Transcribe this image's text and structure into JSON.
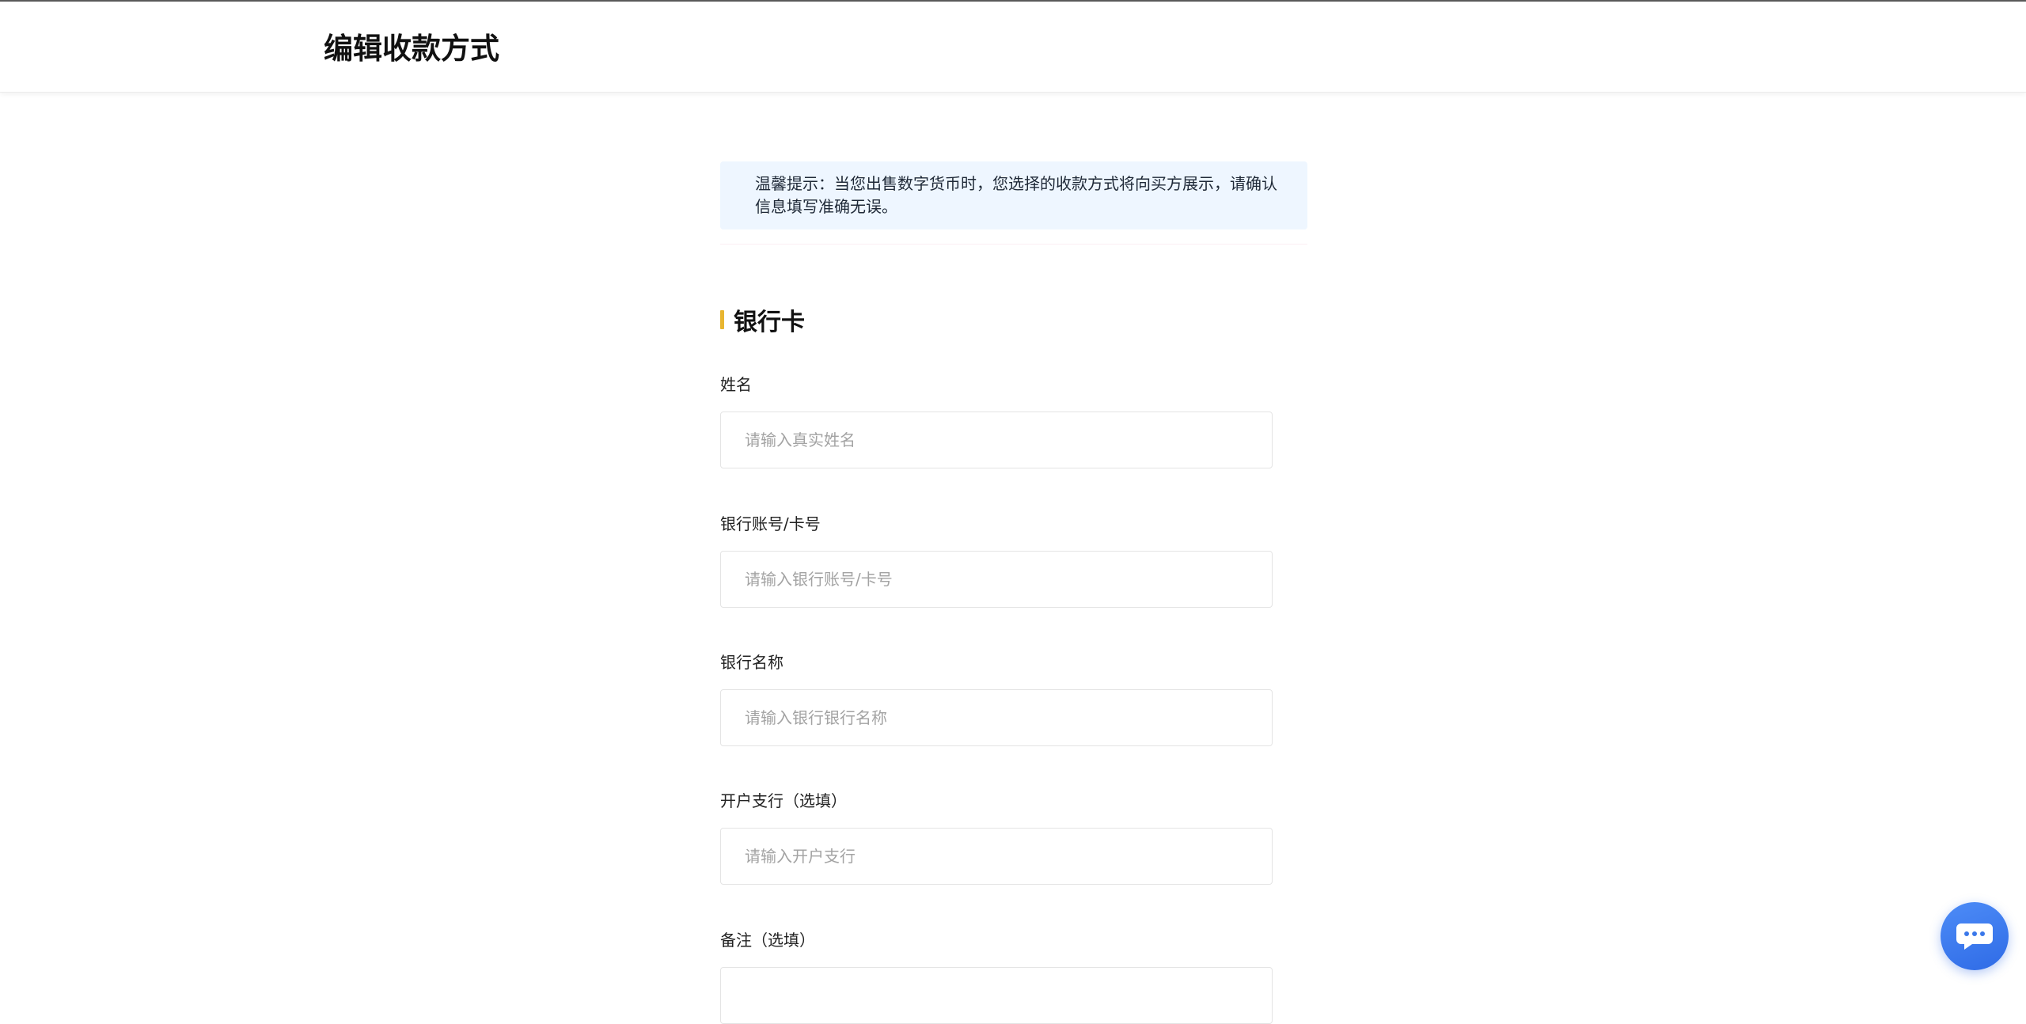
{
  "header": {
    "title": "编辑收款方式"
  },
  "notice": {
    "text": "温馨提示：当您出售数字货币时，您选择的收款方式将向买方展示，请确认信息填写准确无误。"
  },
  "section": {
    "title": "银行卡"
  },
  "fields": [
    {
      "label": "姓名",
      "placeholder": "请输入真实姓名",
      "value": ""
    },
    {
      "label": "银行账号/卡号",
      "placeholder": "请输入银行账号/卡号",
      "value": ""
    },
    {
      "label": "银行名称",
      "placeholder": "请输入银行银行名称",
      "value": ""
    },
    {
      "label": "开户支行（选填）",
      "placeholder": "请输入开户支行",
      "value": ""
    },
    {
      "label": "备注（选填）",
      "placeholder": "",
      "value": ""
    }
  ],
  "chat": {
    "icon": "chat-bubble-icon"
  },
  "colors": {
    "accent": "#e8b530",
    "notice_bg": "#eef6ff",
    "chat_blue": "#2f6be6"
  }
}
